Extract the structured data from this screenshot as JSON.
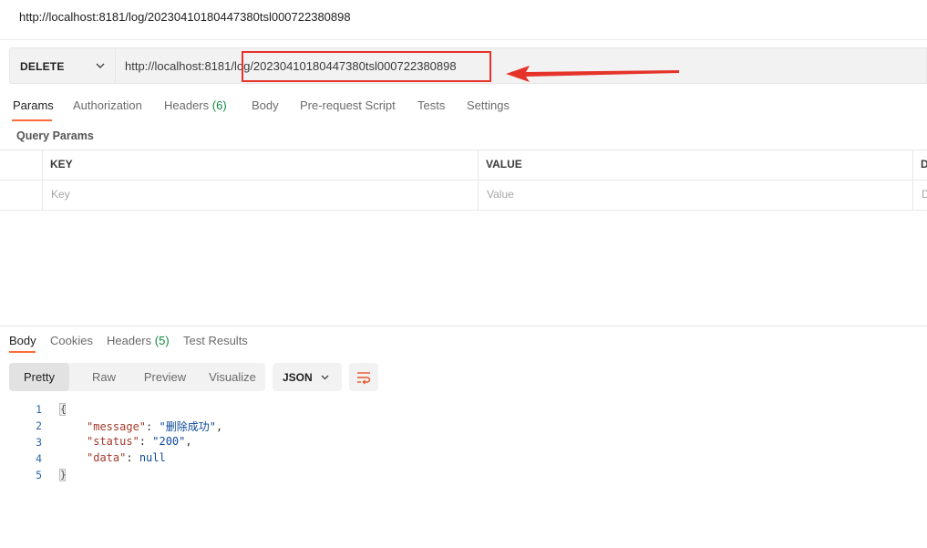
{
  "window": {
    "title": "http://localhost:8181/log/20230410180447380tsl000722380898"
  },
  "request": {
    "method": "DELETE",
    "url": "http://localhost:8181/log/20230410180447380tsl000722380898"
  },
  "request_tabs": [
    {
      "label": "Params",
      "active": true
    },
    {
      "label": "Authorization"
    },
    {
      "label": "Headers",
      "count": "(6)"
    },
    {
      "label": "Body"
    },
    {
      "label": "Pre-request Script"
    },
    {
      "label": "Tests"
    },
    {
      "label": "Settings"
    }
  ],
  "query_params": {
    "title": "Query Params",
    "columns": [
      "KEY",
      "VALUE",
      "D"
    ],
    "placeholders": [
      "Key",
      "Value",
      "D"
    ]
  },
  "response_tabs": [
    {
      "label": "Body",
      "active": true
    },
    {
      "label": "Cookies"
    },
    {
      "label": "Headers",
      "count": "(5)"
    },
    {
      "label": "Test Results"
    }
  ],
  "view_modes": [
    "Pretty",
    "Raw",
    "Preview",
    "Visualize"
  ],
  "active_view": "Pretty",
  "format": "JSON",
  "code": {
    "line_numbers": [
      "1",
      "2",
      "3",
      "4",
      "5"
    ],
    "open_brace": "{",
    "close_brace": "}",
    "lines": [
      {
        "key": "\"message\"",
        "value": "\"删除成功\"",
        "comma": ","
      },
      {
        "key": "\"status\"",
        "value": "\"200\"",
        "comma": ","
      },
      {
        "key": "\"data\"",
        "value": "null",
        "comma": ""
      }
    ],
    "colon": ": "
  },
  "colors": {
    "accent": "#ff6c37",
    "annotation": "#e5332a",
    "count_green": "#0f8a3c"
  },
  "icons": [
    "chevron-down-icon",
    "wrap-lines-icon",
    "annotation-arrow-icon"
  ]
}
